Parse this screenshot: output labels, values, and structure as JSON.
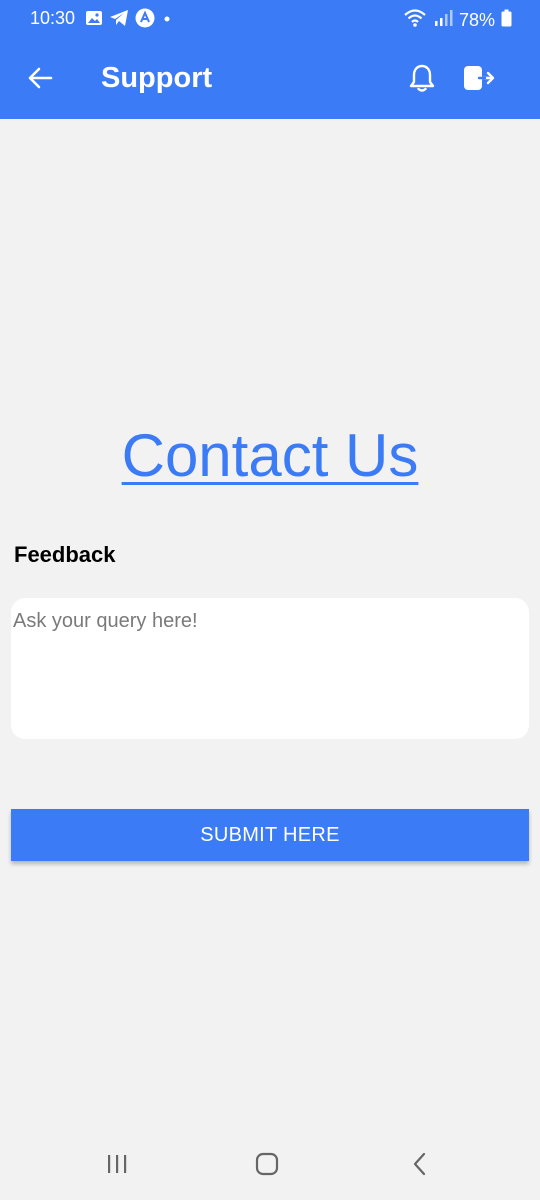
{
  "status_bar": {
    "time": "10:30",
    "battery": "78%",
    "icons": [
      "image-icon",
      "telegram-icon",
      "app-a-icon",
      "dot-icon",
      "wifi-icon",
      "signal-icon",
      "battery-icon"
    ]
  },
  "app_bar": {
    "title": "Support",
    "icons": [
      "back-arrow-icon",
      "bell-icon",
      "logout-icon"
    ]
  },
  "main": {
    "heading": "Contact Us",
    "feedback_label": "Feedback",
    "feedback_placeholder": "Ask your query here!",
    "submit_label": "SUBMIT HERE"
  },
  "nav_bar": {
    "icons": [
      "recent-apps-icon",
      "home-icon",
      "back-icon"
    ]
  },
  "colors": {
    "accent": "#3b7bf5",
    "background": "#f2f2f2",
    "input_background": "#ffffff"
  }
}
